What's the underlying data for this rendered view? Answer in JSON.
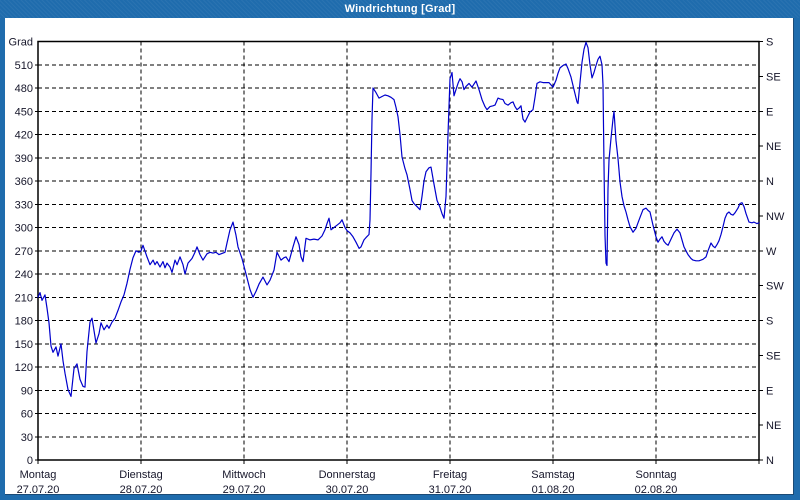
{
  "window": {
    "title": "Windrichtung [Grad]"
  },
  "colors": {
    "titlebar": "#1f6cad",
    "line": "#0000cc",
    "grid": "#000000",
    "text": "#16162a"
  },
  "chart_data": {
    "type": "line",
    "title": "Windrichtung [Grad]",
    "ylabel": "Grad",
    "ylim": [
      0,
      540
    ],
    "y_tick_step": 30,
    "y_tick_labels": [
      "0",
      "30",
      "60",
      "90",
      "120",
      "150",
      "180",
      "210",
      "240",
      "270",
      "300",
      "330",
      "360",
      "390",
      "420",
      "450",
      "480",
      "510"
    ],
    "grid": true,
    "right_axis": {
      "tick_step_deg": 45,
      "labels_bottom_to_top": [
        "N",
        "NE",
        "E",
        "SE",
        "S",
        "SW",
        "W",
        "NW",
        "N",
        "NE",
        "E",
        "SE",
        "S"
      ]
    },
    "x_axis": {
      "unit": "days",
      "range_days": 7,
      "days": [
        {
          "name": "Montag",
          "date": "27.07.20"
        },
        {
          "name": "Dienstag",
          "date": "28.07.20"
        },
        {
          "name": "Mittwoch",
          "date": "29.07.20"
        },
        {
          "name": "Donnerstag",
          "date": "30.07.20"
        },
        {
          "name": "Freitag",
          "date": "31.07.20"
        },
        {
          "name": "Samstag",
          "date": "01.08.20"
        },
        {
          "name": "Sonntag",
          "date": "02.08.20"
        }
      ]
    },
    "series": [
      {
        "name": "Windrichtung",
        "points": [
          [
            0.0,
            210
          ],
          [
            0.019,
            216
          ],
          [
            0.039,
            206
          ],
          [
            0.068,
            213
          ],
          [
            0.087,
            196
          ],
          [
            0.107,
            177
          ],
          [
            0.126,
            147
          ],
          [
            0.146,
            139
          ],
          [
            0.175,
            146
          ],
          [
            0.194,
            134
          ],
          [
            0.223,
            150
          ],
          [
            0.243,
            128
          ],
          [
            0.262,
            112
          ],
          [
            0.291,
            91
          ],
          [
            0.32,
            82
          ],
          [
            0.35,
            118
          ],
          [
            0.379,
            124
          ],
          [
            0.408,
            104
          ],
          [
            0.437,
            95
          ],
          [
            0.456,
            94
          ],
          [
            0.476,
            140
          ],
          [
            0.505,
            178
          ],
          [
            0.524,
            183
          ],
          [
            0.563,
            151
          ],
          [
            0.592,
            163
          ],
          [
            0.612,
            177
          ],
          [
            0.641,
            168
          ],
          [
            0.67,
            174
          ],
          [
            0.689,
            170
          ],
          [
            0.718,
            178
          ],
          [
            0.748,
            183
          ],
          [
            0.777,
            193
          ],
          [
            0.806,
            204
          ],
          [
            0.835,
            213
          ],
          [
            0.864,
            228
          ],
          [
            0.893,
            246
          ],
          [
            0.922,
            261
          ],
          [
            0.951,
            270
          ],
          [
            0.981,
            268
          ],
          [
            1.0,
            270
          ],
          [
            1.019,
            277
          ],
          [
            1.058,
            262
          ],
          [
            1.087,
            252
          ],
          [
            1.117,
            258
          ],
          [
            1.136,
            252
          ],
          [
            1.155,
            256
          ],
          [
            1.184,
            249
          ],
          [
            1.214,
            256
          ],
          [
            1.233,
            248
          ],
          [
            1.252,
            254
          ],
          [
            1.282,
            249
          ],
          [
            1.301,
            242
          ],
          [
            1.33,
            258
          ],
          [
            1.35,
            252
          ],
          [
            1.379,
            262
          ],
          [
            1.408,
            252
          ],
          [
            1.427,
            240
          ],
          [
            1.456,
            254
          ],
          [
            1.495,
            260
          ],
          [
            1.524,
            268
          ],
          [
            1.544,
            275
          ],
          [
            1.573,
            265
          ],
          [
            1.602,
            258
          ],
          [
            1.641,
            266
          ],
          [
            1.67,
            268
          ],
          [
            1.699,
            267
          ],
          [
            1.728,
            268
          ],
          [
            1.757,
            265
          ],
          [
            1.796,
            267
          ],
          [
            1.816,
            268
          ],
          [
            1.835,
            280
          ],
          [
            1.864,
            297
          ],
          [
            1.893,
            307
          ],
          [
            1.922,
            290
          ],
          [
            1.942,
            275
          ],
          [
            1.981,
            260
          ],
          [
            2.01,
            245
          ],
          [
            2.029,
            235
          ],
          [
            2.058,
            220
          ],
          [
            2.087,
            210
          ],
          [
            2.117,
            218
          ],
          [
            2.146,
            227
          ],
          [
            2.184,
            236
          ],
          [
            2.223,
            226
          ],
          [
            2.252,
            232
          ],
          [
            2.291,
            245
          ],
          [
            2.32,
            268
          ],
          [
            2.359,
            258
          ],
          [
            2.388,
            261
          ],
          [
            2.408,
            262
          ],
          [
            2.437,
            256
          ],
          [
            2.476,
            275
          ],
          [
            2.505,
            288
          ],
          [
            2.534,
            278
          ],
          [
            2.553,
            262
          ],
          [
            2.573,
            256
          ],
          [
            2.602,
            286
          ],
          [
            2.641,
            284
          ],
          [
            2.68,
            285
          ],
          [
            2.718,
            284
          ],
          [
            2.757,
            289
          ],
          [
            2.786,
            297
          ],
          [
            2.806,
            305
          ],
          [
            2.825,
            312
          ],
          [
            2.845,
            297
          ],
          [
            2.874,
            300
          ],
          [
            2.903,
            303
          ],
          [
            2.932,
            306
          ],
          [
            2.951,
            310
          ],
          [
            2.981,
            300
          ],
          [
            3.0,
            296
          ],
          [
            3.029,
            293
          ],
          [
            3.058,
            288
          ],
          [
            3.087,
            281
          ],
          [
            3.117,
            273
          ],
          [
            3.136,
            275
          ],
          [
            3.165,
            284
          ],
          [
            3.184,
            287
          ],
          [
            3.214,
            291
          ],
          [
            3.223,
            310
          ],
          [
            3.233,
            370
          ],
          [
            3.243,
            440
          ],
          [
            3.252,
            480
          ],
          [
            3.282,
            474
          ],
          [
            3.311,
            467
          ],
          [
            3.34,
            469
          ],
          [
            3.369,
            471
          ],
          [
            3.398,
            470
          ],
          [
            3.427,
            468
          ],
          [
            3.456,
            465
          ],
          [
            3.476,
            455
          ],
          [
            3.495,
            443
          ],
          [
            3.515,
            420
          ],
          [
            3.534,
            391
          ],
          [
            3.563,
            376
          ],
          [
            3.583,
            368
          ],
          [
            3.612,
            349
          ],
          [
            3.631,
            335
          ],
          [
            3.65,
            331
          ],
          [
            3.68,
            327
          ],
          [
            3.709,
            323
          ],
          [
            3.728,
            340
          ],
          [
            3.748,
            360
          ],
          [
            3.767,
            372
          ],
          [
            3.796,
            377
          ],
          [
            3.816,
            378
          ],
          [
            3.845,
            356
          ],
          [
            3.874,
            335
          ],
          [
            3.903,
            326
          ],
          [
            3.922,
            318
          ],
          [
            3.942,
            312
          ],
          [
            3.961,
            340
          ],
          [
            3.981,
            420
          ],
          [
            4.0,
            492
          ],
          [
            4.019,
            500
          ],
          [
            4.039,
            470
          ],
          [
            4.058,
            478
          ],
          [
            4.078,
            486
          ],
          [
            4.097,
            492
          ],
          [
            4.117,
            488
          ],
          [
            4.136,
            478
          ],
          [
            4.155,
            482
          ],
          [
            4.184,
            486
          ],
          [
            4.214,
            481
          ],
          [
            4.233,
            485
          ],
          [
            4.252,
            489
          ],
          [
            4.282,
            478
          ],
          [
            4.311,
            465
          ],
          [
            4.34,
            456
          ],
          [
            4.359,
            452
          ],
          [
            4.388,
            456
          ],
          [
            4.417,
            457
          ],
          [
            4.437,
            458
          ],
          [
            4.466,
            467
          ],
          [
            4.485,
            466
          ],
          [
            4.515,
            465
          ],
          [
            4.534,
            460
          ],
          [
            4.563,
            458
          ],
          [
            4.592,
            461
          ],
          [
            4.612,
            462
          ],
          [
            4.631,
            456
          ],
          [
            4.65,
            452
          ],
          [
            4.67,
            454
          ],
          [
            4.689,
            457
          ],
          [
            4.709,
            440
          ],
          [
            4.728,
            436
          ],
          [
            4.757,
            444
          ],
          [
            4.777,
            449
          ],
          [
            4.806,
            452
          ],
          [
            4.825,
            468
          ],
          [
            4.845,
            486
          ],
          [
            4.874,
            488
          ],
          [
            4.903,
            487
          ],
          [
            4.932,
            487
          ],
          [
            4.961,
            487
          ],
          [
            4.981,
            484
          ],
          [
            5.0,
            481
          ],
          [
            5.029,
            490
          ],
          [
            5.049,
            499
          ],
          [
            5.068,
            506
          ],
          [
            5.097,
            509
          ],
          [
            5.126,
            511
          ],
          [
            5.146,
            505
          ],
          [
            5.175,
            494
          ],
          [
            5.204,
            478
          ],
          [
            5.233,
            462
          ],
          [
            5.243,
            460
          ],
          [
            5.262,
            487
          ],
          [
            5.282,
            513
          ],
          [
            5.301,
            530
          ],
          [
            5.32,
            539
          ],
          [
            5.34,
            532
          ],
          [
            5.359,
            510
          ],
          [
            5.379,
            493
          ],
          [
            5.398,
            500
          ],
          [
            5.417,
            509
          ],
          [
            5.437,
            517
          ],
          [
            5.456,
            521
          ],
          [
            5.476,
            510
          ],
          [
            5.485,
            484
          ],
          [
            5.495,
            380
          ],
          [
            5.505,
            290
          ],
          [
            5.515,
            254
          ],
          [
            5.524,
            251
          ],
          [
            5.534,
            350
          ],
          [
            5.544,
            387
          ],
          [
            5.563,
            415
          ],
          [
            5.583,
            440
          ],
          [
            5.592,
            450
          ],
          [
            5.612,
            412
          ],
          [
            5.631,
            389
          ],
          [
            5.65,
            359
          ],
          [
            5.67,
            340
          ],
          [
            5.689,
            328
          ],
          [
            5.709,
            320
          ],
          [
            5.728,
            310
          ],
          [
            5.748,
            301
          ],
          [
            5.777,
            294
          ],
          [
            5.806,
            299
          ],
          [
            5.825,
            306
          ],
          [
            5.845,
            313
          ],
          [
            5.874,
            323
          ],
          [
            5.903,
            325
          ],
          [
            5.922,
            322
          ],
          [
            5.942,
            320
          ],
          [
            5.971,
            303
          ],
          [
            6.0,
            288
          ],
          [
            6.019,
            281
          ],
          [
            6.039,
            285
          ],
          [
            6.058,
            288
          ],
          [
            6.078,
            282
          ],
          [
            6.097,
            279
          ],
          [
            6.117,
            277
          ],
          [
            6.146,
            285
          ],
          [
            6.175,
            293
          ],
          [
            6.204,
            298
          ],
          [
            6.233,
            293
          ],
          [
            6.252,
            284
          ],
          [
            6.272,
            275
          ],
          [
            6.291,
            270
          ],
          [
            6.311,
            265
          ],
          [
            6.34,
            260
          ],
          [
            6.359,
            258
          ],
          [
            6.388,
            257
          ],
          [
            6.417,
            257
          ],
          [
            6.437,
            258
          ],
          [
            6.456,
            259
          ],
          [
            6.485,
            262
          ],
          [
            6.505,
            270
          ],
          [
            6.534,
            280
          ],
          [
            6.553,
            276
          ],
          [
            6.573,
            274
          ],
          [
            6.592,
            278
          ],
          [
            6.612,
            283
          ],
          [
            6.631,
            291
          ],
          [
            6.65,
            301
          ],
          [
            6.67,
            312
          ],
          [
            6.689,
            318
          ],
          [
            6.709,
            320
          ],
          [
            6.728,
            317
          ],
          [
            6.748,
            316
          ],
          [
            6.767,
            319
          ],
          [
            6.796,
            325
          ],
          [
            6.816,
            331
          ],
          [
            6.835,
            332
          ],
          [
            6.854,
            327
          ],
          [
            6.874,
            318
          ],
          [
            6.903,
            307
          ],
          [
            6.932,
            306
          ],
          [
            6.951,
            307
          ],
          [
            6.981,
            305
          ],
          [
            7.0,
            306
          ]
        ]
      }
    ]
  }
}
